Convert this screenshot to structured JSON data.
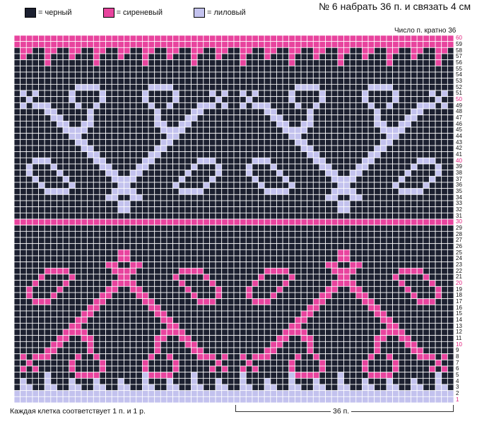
{
  "legend": [
    {
      "color": "#1c2030",
      "label": "= черный"
    },
    {
      "color": "#e8449e",
      "label": "= сиреневый"
    },
    {
      "color": "#c3c2ee",
      "label": "= лиловый"
    }
  ],
  "title": "№ 6 набрать 36 п. и связать 4 см",
  "repeat_note": "Число п. кратно 36",
  "footnote": "Каждая клетка соответствует 1 п. и 1 р.",
  "repeat_label": "36 п.",
  "row_numbers": [
    "1",
    "2",
    "3",
    "4",
    "5",
    "6",
    "7",
    "8",
    "9",
    "10",
    "11",
    "12",
    "13",
    "14",
    "15",
    "16",
    "17",
    "18",
    "19",
    "20",
    "21",
    "22",
    "23",
    "24",
    "25",
    "26",
    "27",
    "28",
    "29",
    "30",
    "31",
    "32",
    "33",
    "34",
    "35",
    "36",
    "37",
    "38",
    "39",
    "40",
    "41",
    "42",
    "43",
    "44",
    "45",
    "46",
    "47",
    "48",
    "49",
    "50",
    "51",
    "52",
    "53",
    "54",
    "55",
    "56",
    "57",
    "58",
    "59",
    "60"
  ],
  "highlighted_rows": [
    "1",
    "10",
    "20",
    "30",
    "40",
    "50",
    "60"
  ],
  "colors": {
    "black": "#1c2030",
    "pink": "#e8449e",
    "lilac": "#c3c2ee",
    "grid": "#ffffff",
    "highlight": "#e01b7b"
  }
}
